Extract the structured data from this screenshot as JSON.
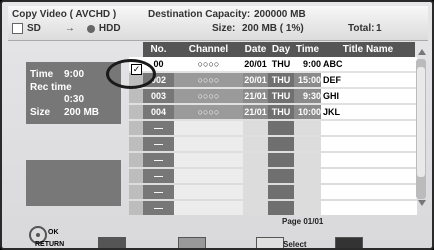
{
  "header": {
    "mode_title": "Copy Video ( AVCHD )",
    "source": "SD",
    "arrow": "→",
    "dest": "HDD",
    "dest_capacity_label": "Destination Capacity:",
    "dest_capacity_value": "200000 MB",
    "size_label": "Size:",
    "size_value": "200 MB ( 1%)",
    "total_label": "Total:",
    "total_value": "1"
  },
  "sidebar": {
    "time_label": "Time",
    "time_value": "9:00",
    "rec_time_label": "Rec time",
    "rec_time_value": "0:30",
    "size_label": "Size",
    "size_value": "200 MB"
  },
  "table": {
    "headers": [
      "No.",
      "Channel",
      "Date",
      "Day",
      "Time",
      "Title Name"
    ],
    "rows": [
      {
        "no": "00",
        "channel": "○○○○",
        "date": "20/01",
        "day": "THU",
        "time": "9:00",
        "title": "ABC",
        "checked": true
      },
      {
        "no": "002",
        "channel": "○○○○",
        "date": "20/01",
        "day": "THU",
        "time": "15:00",
        "title": "DEF",
        "checked": false
      },
      {
        "no": "003",
        "channel": "○○○○",
        "date": "21/01",
        "day": "THU",
        "time": "9:30",
        "title": "GHI",
        "checked": false
      },
      {
        "no": "004",
        "channel": "○○○○",
        "date": "21/01",
        "day": "THU",
        "time": "10:00",
        "title": "JKL",
        "checked": false
      },
      {
        "no": "—"
      },
      {
        "no": "—"
      },
      {
        "no": "—"
      },
      {
        "no": "—"
      },
      {
        "no": "—"
      },
      {
        "no": "—"
      }
    ]
  },
  "page": "Page 01/01",
  "footer": {
    "ok": "OK",
    "return": "RETURN",
    "select": "Select",
    "buttons": [
      "#555",
      "#999",
      "#e0e0e0",
      "#333"
    ]
  },
  "colors": {
    "selected_row": "#ffffff",
    "row_dark": "#8c8c8c",
    "row_mid": "#a7a7a7",
    "column_mid": "#777777",
    "empty_row": "#ececec"
  }
}
